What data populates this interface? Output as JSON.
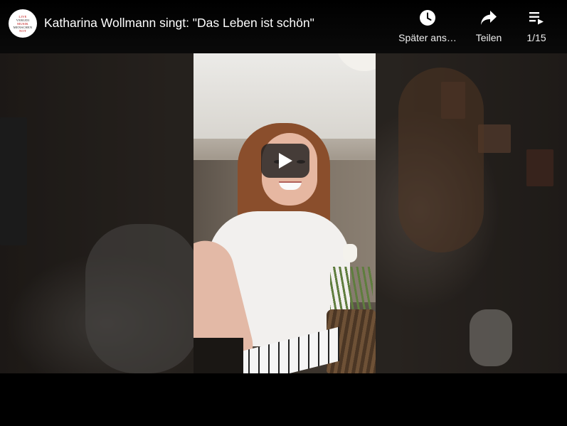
{
  "video": {
    "title": "Katharina Wollmann singt: \"Das Leben ist schön\""
  },
  "channel": {
    "avatar_icon": "channel-logo-icon",
    "logo_lines": [
      "LIVE",
      "VERUDI",
      "MUSIK",
      "MENSCHEN",
      "NOT"
    ]
  },
  "actions": {
    "watch_later": {
      "label": "Später ans…",
      "icon": "clock-icon"
    },
    "share": {
      "label": "Teilen",
      "icon": "share-arrow-icon"
    },
    "playlist": {
      "label": "1/15",
      "icon": "playlist-icon"
    }
  },
  "controls": {
    "play_icon": "play-icon"
  },
  "colors": {
    "background": "#000000",
    "text": "#ffffff",
    "play_button_bg": "#212121",
    "logo_red": "#bb0000"
  }
}
